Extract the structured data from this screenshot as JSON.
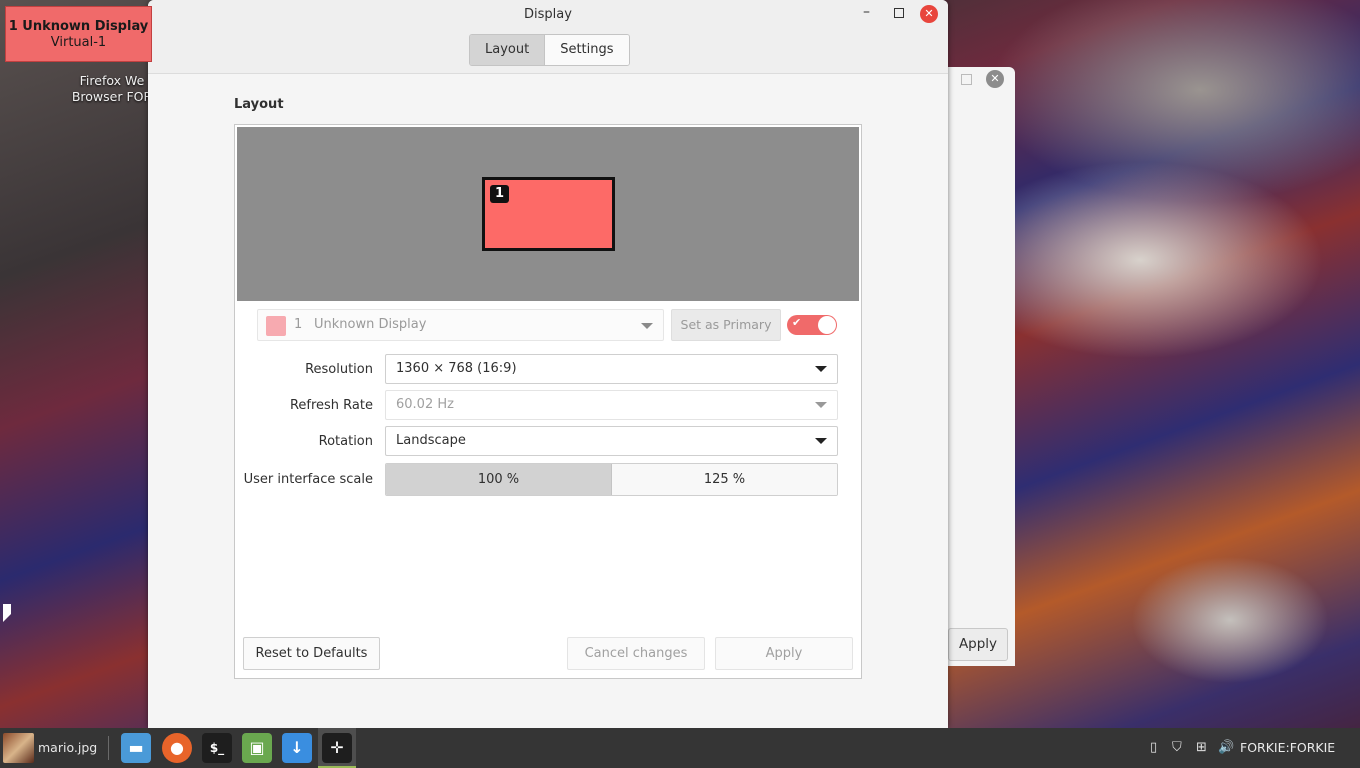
{
  "osd": {
    "line1": "1  Unknown Display",
    "line2": "Virtual-1"
  },
  "desktop_icon": {
    "line1": "Firefox We",
    "line2": "Browser FOR"
  },
  "background_window": {
    "apply_label": "Apply"
  },
  "window": {
    "title": "Display",
    "tabs": [
      {
        "label": "Layout",
        "active": true
      },
      {
        "label": "Settings",
        "active": false
      }
    ],
    "section_title": "Layout",
    "monitor_badge": "1",
    "monitor_color": "#fd6a67",
    "display_select": {
      "number": "1",
      "name": "Unknown Display",
      "swatch_color": "#f7aab0"
    },
    "set_primary_label": "Set as Primary",
    "toggle": {
      "enabled": true,
      "check": "✔"
    },
    "fields": {
      "resolution": {
        "label": "Resolution",
        "value": "1360 × 768 (16:9)"
      },
      "refresh_rate": {
        "label": "Refresh Rate",
        "value": "60.02 Hz"
      },
      "rotation": {
        "label": "Rotation",
        "value": "Landscape"
      },
      "scale": {
        "label": "User interface scale",
        "options": [
          "100 %",
          "125 %"
        ],
        "selected": "100 %"
      }
    },
    "buttons": {
      "reset": "Reset to Defaults",
      "cancel": "Cancel changes",
      "apply": "Apply"
    }
  },
  "taskbar": {
    "window_label": "mario.jpg",
    "apps": [
      {
        "icon": "folder-icon",
        "color": "#4a9ad8"
      },
      {
        "icon": "firefox-icon",
        "color": "#e8642a"
      },
      {
        "icon": "terminal-icon",
        "color": "#1e1e1e"
      },
      {
        "icon": "mint-update-icon",
        "color": "#6aa84f"
      },
      {
        "icon": "download-icon",
        "color": "#3a8ee0"
      },
      {
        "icon": "move-arrows-icon",
        "color": "#1e1e1e"
      }
    ],
    "user": "FORKIE:FORKIE"
  }
}
